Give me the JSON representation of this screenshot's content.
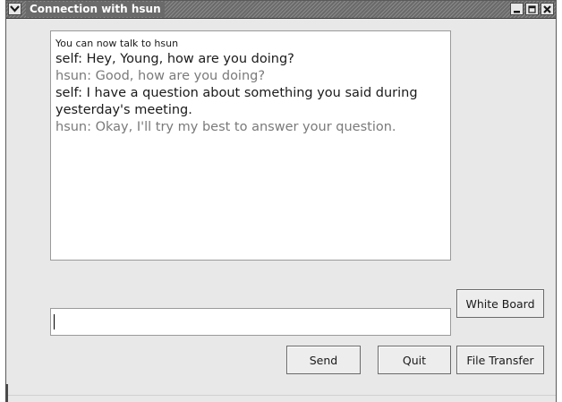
{
  "window": {
    "title": "Connection with hsun"
  },
  "chat": {
    "system_message": "You can now talk to hsun",
    "messages": [
      {
        "speaker": "self",
        "text": "self: Hey, Young, how are you doing?"
      },
      {
        "speaker": "remote",
        "text": "hsun: Good, how are you doing?"
      },
      {
        "speaker": "self",
        "text": "self: I have a question about something you said during yesterday's meeting."
      },
      {
        "speaker": "remote",
        "text": "hsun: Okay, I'll try my best to answer your question."
      }
    ]
  },
  "input": {
    "value": "",
    "placeholder": ""
  },
  "buttons": {
    "white_board": "White Board",
    "send": "Send",
    "quit": "Quit",
    "file_transfer": "File Transfer"
  },
  "colors": {
    "self_text": "#1a1a1a",
    "remote_text": "#7a7a7a",
    "window_bg": "#e8e8e8"
  }
}
